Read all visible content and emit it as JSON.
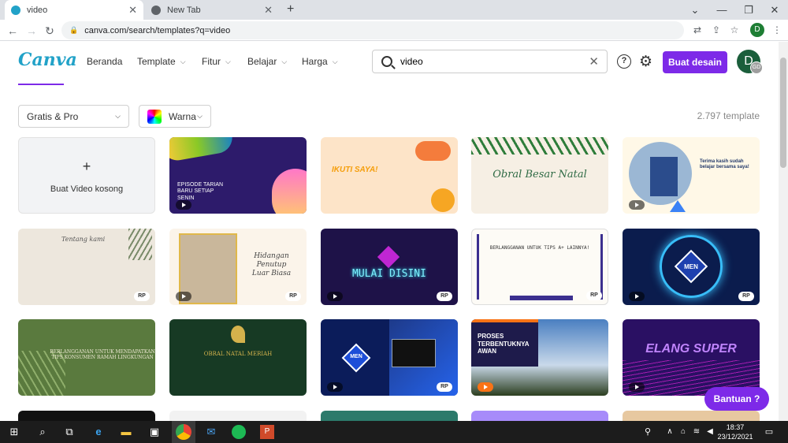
{
  "browser": {
    "tabs": [
      {
        "title": "video"
      },
      {
        "title": "New Tab"
      }
    ],
    "url": "canva.com/search/templates?q=video",
    "profile_initial": "D"
  },
  "header": {
    "logo": "Canva",
    "nav": [
      {
        "label": "Beranda"
      },
      {
        "label": "Template"
      },
      {
        "label": "Fitur"
      },
      {
        "label": "Belajar"
      },
      {
        "label": "Harga"
      }
    ],
    "search_value": "video",
    "help_label": "?",
    "cta": "Buat desain",
    "avatar_initial": "D",
    "avatar_badge": "GD",
    "accent": "#7d2ae8"
  },
  "filters": {
    "plan": "Gratis & Pro",
    "color": "Warna",
    "count": "2.797 template"
  },
  "cards": {
    "blank": {
      "plus": "+",
      "label": "Buat Video kosong"
    },
    "c1": {
      "title": "EPISODE TARIAN\nBARU SETIAP\nSENIN",
      "bg": "#2d1b6b"
    },
    "c2": {
      "title": "IKUTI SAYA!",
      "bg": "#fde4c8"
    },
    "c3": {
      "title": "Obral Besar Natal",
      "bg": "#f6efe4"
    },
    "c4": {
      "title": "Terima kasih sudah\nbelajar bersama saya!",
      "bg": "#fff8e7"
    },
    "c5": {
      "title": "Tentang kami",
      "bg": "#ede7dd"
    },
    "c6": {
      "title": "Hidangan\nPenutup\nLuar Biasa",
      "bg": "#fbf4ea"
    },
    "c7": {
      "title": "MULAI DISINI",
      "bg": "#1e1248"
    },
    "c8": {
      "title": "BERLANGGANAN UNTUK TIPS A+ LAINNYA!",
      "bg": "#fdfbf6"
    },
    "c9": {
      "title": "MEN",
      "bg": "#0b1c4d"
    },
    "c10": {
      "title": "BERLANGGANAN UNTUK MENDAPATKAN\nTIPS KONSUMEN RAMAH LINGKUNGAN",
      "bg": "#5a7a3e"
    },
    "c11": {
      "title": "OBRAL NATAL MERIAH",
      "bg": "#173a24"
    },
    "c12": {
      "title": "MEN",
      "bg": "#0b1c5a"
    },
    "c13": {
      "title": "PROSES\nTERBENTUKNYA\nAWAN",
      "bg": "#3a6fb5"
    },
    "c14": {
      "title": "ELANG SUPER",
      "bg": "#2a1063"
    },
    "badge": "RP"
  },
  "help_button": "Bantuan  ?",
  "taskbar": {
    "time": "18:37",
    "date": "23/12/2021"
  }
}
